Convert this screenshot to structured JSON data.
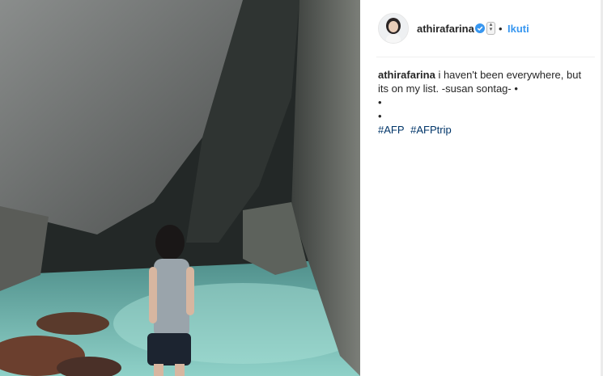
{
  "post": {
    "username": "athirafarina",
    "separator": "•",
    "follow_label": "Ikuti",
    "caption_text": "i haven't been everywhere, but its on my list. -susan sontag- •",
    "caption_lines": [
      "•",
      "•"
    ],
    "hashtags": [
      "#AFP",
      "#AFPtrip"
    ]
  },
  "icons": {
    "verified": "verified-badge-icon",
    "toggle": "updown-toggle-icon"
  },
  "colors": {
    "accent": "#3897f0",
    "hashtag": "#003569",
    "text": "#262626"
  }
}
